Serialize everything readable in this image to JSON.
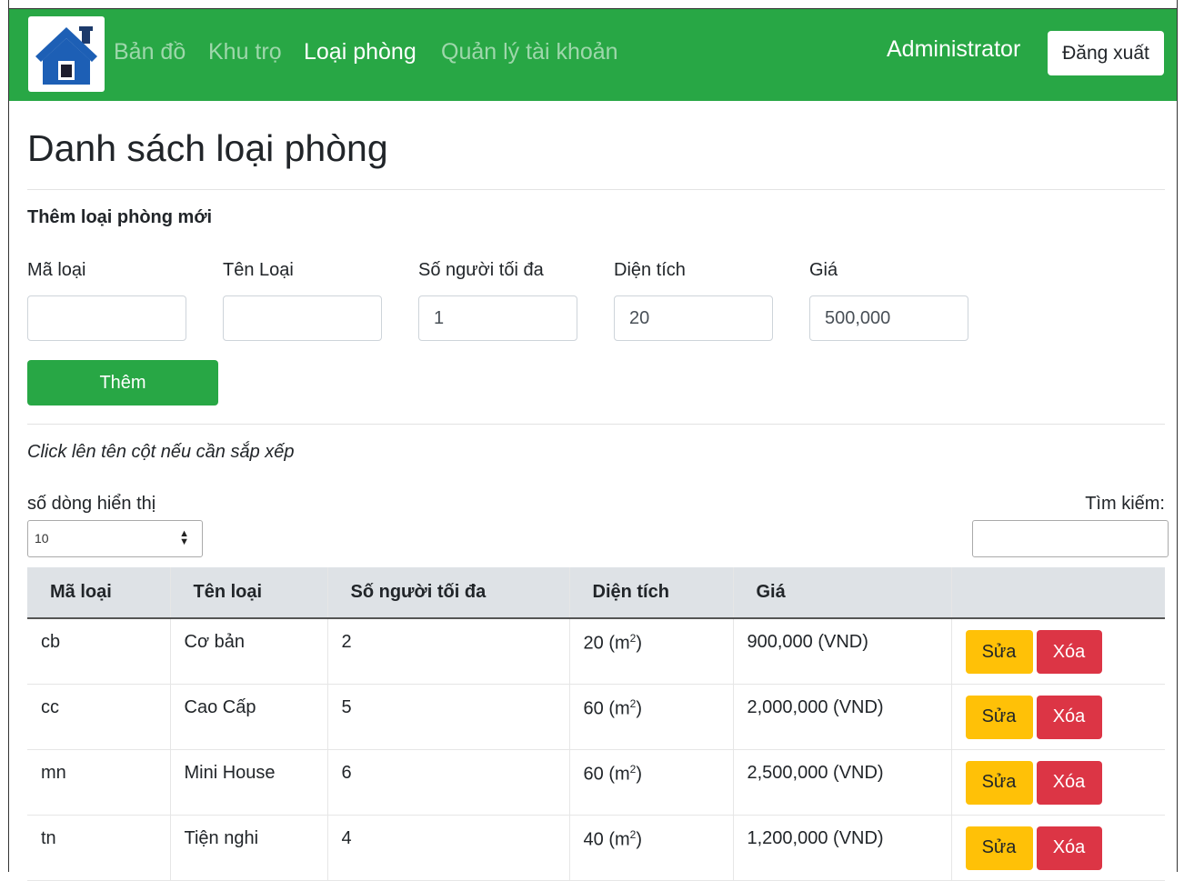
{
  "nav": {
    "links": [
      "Bản đồ",
      "Khu trọ",
      "Loại phòng",
      "Quản lý tài khoản"
    ],
    "user": "Administrator",
    "logout": "Đăng xuất"
  },
  "page_title": "Danh sách loại phòng",
  "form": {
    "title": "Thêm loại phòng mới",
    "fields": [
      {
        "label": "Mã loại",
        "value": ""
      },
      {
        "label": "Tên Loại",
        "value": ""
      },
      {
        "label": "Số người tối đa",
        "value": "1"
      },
      {
        "label": "Diện tích",
        "value": "20"
      },
      {
        "label": "Giá",
        "value": "500,000"
      }
    ],
    "submit": "Thêm"
  },
  "hint": "Click lên tên cột nếu cần sắp xếp",
  "length": {
    "label": "số dòng hiển thị",
    "value": "10"
  },
  "search": {
    "label": "Tìm kiếm:"
  },
  "table": {
    "headers": [
      "Mã loại",
      "Tên loại",
      "Số người tối đa",
      "Diện tích",
      "Giá",
      ""
    ],
    "rows": [
      {
        "code": "cb",
        "name": "Cơ bản",
        "max": "2",
        "area": "20",
        "price": "900,000 (VND)"
      },
      {
        "code": "cc",
        "name": "Cao Cấp",
        "max": "5",
        "area": "60",
        "price": "2,000,000 (VND)"
      },
      {
        "code": "mn",
        "name": "Mini House",
        "max": "6",
        "area": "60",
        "price": "2,500,000 (VND)"
      },
      {
        "code": "tn",
        "name": "Tiện nghi",
        "max": "4",
        "area": "40",
        "price": "1,200,000 (VND)"
      }
    ],
    "area_unit_prefix": "(m",
    "area_unit_sup": "2",
    "area_unit_suffix": ")",
    "edit": "Sửa",
    "delete": "Xóa"
  },
  "colors": {
    "navbar": "#28a745",
    "edit": "#ffc107",
    "delete": "#dc3545"
  },
  "icons": {
    "logo": "house-icon"
  }
}
